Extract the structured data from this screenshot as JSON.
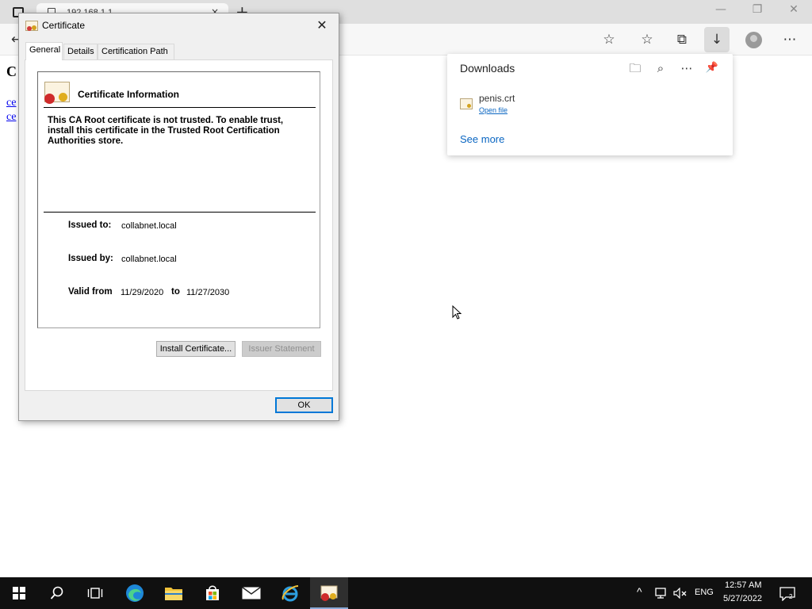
{
  "browser": {
    "tab_title": "192.168.1.1",
    "tab_close": "×",
    "new_tab": "+",
    "window_controls": {
      "minimize": "—",
      "restore": "❐",
      "close": "✕"
    },
    "toolbar_icons": {
      "back": "←",
      "favorite_add": "☆",
      "favorites": "☆",
      "collections": "⧉",
      "downloads": "↓",
      "more": "⋯"
    }
  },
  "page": {
    "heading": "C",
    "links": [
      "ce",
      "ce"
    ]
  },
  "downloads": {
    "title": "Downloads",
    "file_name": "penis.crt",
    "open_label": "Open file",
    "see_more": "See more",
    "icons": {
      "folder": "🗀",
      "search": "⌕",
      "more": "⋯",
      "pin": "📌"
    }
  },
  "dialog": {
    "title": "Certificate",
    "close": "✕",
    "tabs": [
      "General",
      "Details",
      "Certification Path"
    ],
    "info_heading": "Certificate Information",
    "warning": "This CA Root certificate is not trusted. To enable trust, install this certificate in the Trusted Root Certification Authorities store.",
    "issued_to_label": "Issued to:",
    "issued_to": "collabnet.local",
    "issued_by_label": "Issued by:",
    "issued_by": "collabnet.local",
    "valid_from_label": "Valid from",
    "valid_from": "11/29/2020",
    "to_label": "to",
    "valid_to": "11/27/2030",
    "install_button": "Install Certificate...",
    "issuer_button": "Issuer Statement",
    "ok_button": "OK"
  },
  "taskbar": {
    "chevron": "^",
    "language": "ENG",
    "time": "12:57 AM",
    "date": "5/27/2022",
    "notification_count": "2"
  }
}
